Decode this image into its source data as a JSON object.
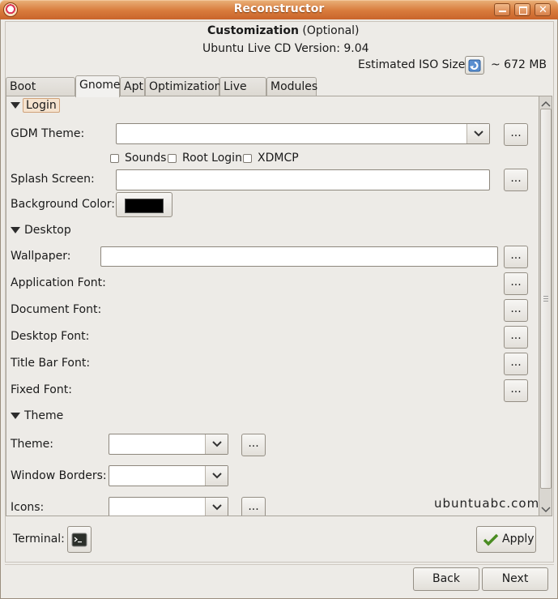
{
  "window": {
    "title": "Reconstructor"
  },
  "header": {
    "heading": "Customization",
    "heading_suffix": "(Optional)",
    "version": "Ubuntu Live CD Version: 9.04",
    "iso_label": "Estimated ISO Size:",
    "iso_value": "~ 672 MB"
  },
  "tabs": [
    {
      "label": "Boot Screen",
      "active": false
    },
    {
      "label": "Gnome",
      "active": true
    },
    {
      "label": "Apt",
      "active": false
    },
    {
      "label": "Optimization",
      "active": false
    },
    {
      "label": "Live CD",
      "active": false
    },
    {
      "label": "Modules",
      "active": false
    }
  ],
  "login": {
    "section_label": "Login",
    "gdm_theme_label": "GDM Theme:",
    "gdm_theme_value": "",
    "sounds_label": "Sounds",
    "root_login_label": "Root Login",
    "xdmcp_label": "XDMCP",
    "splash_label": "Splash Screen:",
    "splash_value": "",
    "bg_color_label": "Background Color:",
    "bg_color": "#000000"
  },
  "desktop": {
    "section_label": "Desktop",
    "wallpaper_label": "Wallpaper:",
    "wallpaper_value": "",
    "app_font_label": "Application Font:",
    "doc_font_label": "Document Font:",
    "desktop_font_label": "Desktop Font:",
    "title_font_label": "Title Bar Font:",
    "fixed_font_label": "Fixed Font:"
  },
  "theme": {
    "section_label": "Theme",
    "theme_label": "Theme:",
    "theme_value": "",
    "borders_label": "Window Borders:",
    "borders_value": "",
    "icons_label": "Icons:",
    "icons_value": ""
  },
  "browse_label": "...",
  "watermark": "ubuntuabc.com",
  "footer": {
    "terminal_label": "Terminal:",
    "apply_label": "Apply",
    "back_label": "Back",
    "next_label": "Next"
  },
  "colors": {
    "titlebar": "#d87b3c",
    "accent": "#4a8c22"
  },
  "icons": [
    "close-icon",
    "minimize-icon",
    "maximize-icon",
    "refresh-icon",
    "terminal-icon",
    "checkmark-icon",
    "expander-icon",
    "chevron-down-icon"
  ]
}
